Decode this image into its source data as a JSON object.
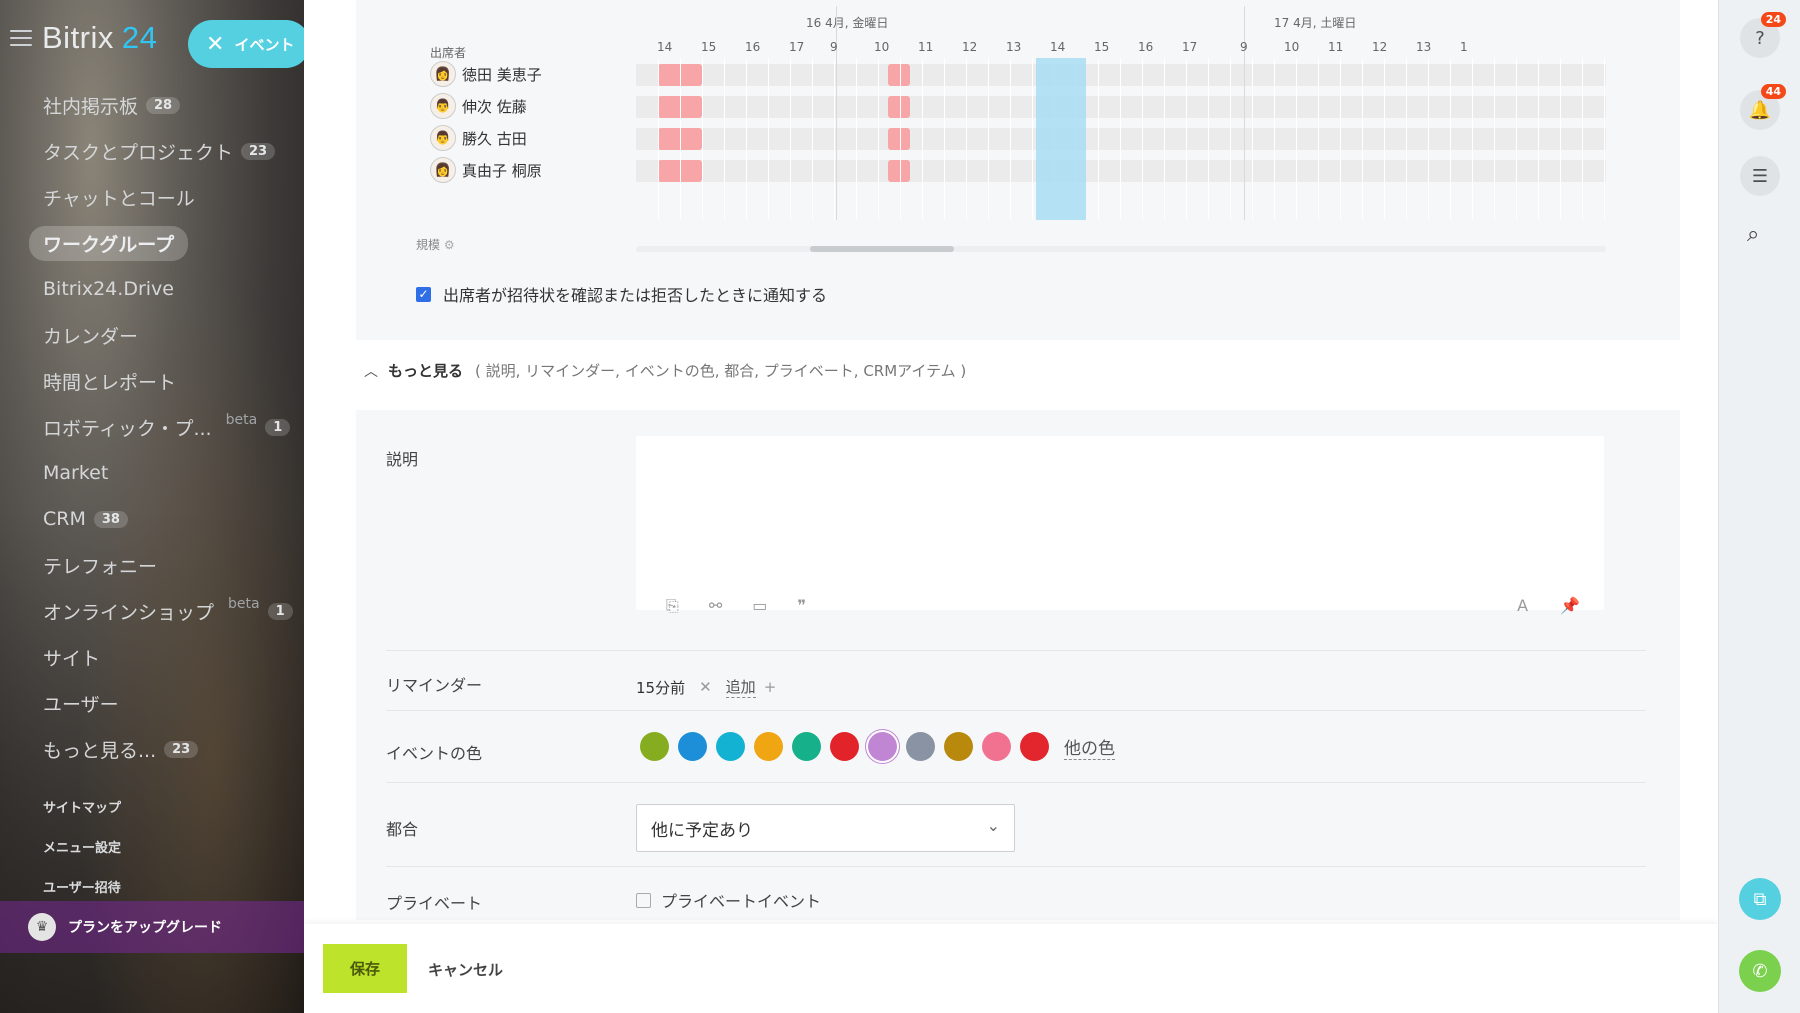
{
  "sidebar": {
    "logo_main": "Bitrix",
    "logo_num": "24",
    "event_pill": "イベント",
    "items": [
      {
        "label": "社内掲示板",
        "count": "28"
      },
      {
        "label": "タスクとプロジェクト",
        "count": "23"
      },
      {
        "label": "チャットとコール",
        "count": ""
      },
      {
        "label": "ワークグループ",
        "count": ""
      },
      {
        "label": "Bitrix24.Drive",
        "count": ""
      },
      {
        "label": "カレンダー",
        "count": ""
      },
      {
        "label": "時間とレポート",
        "count": ""
      },
      {
        "label": "ロボティック・プ...",
        "count": "1",
        "beta": "beta"
      },
      {
        "label": "Market",
        "count": ""
      },
      {
        "label": "CRM",
        "count": "38"
      },
      {
        "label": "テレフォニー",
        "count": ""
      },
      {
        "label": "オンラインショップ",
        "count": "1",
        "beta": "beta"
      },
      {
        "label": "サイト",
        "count": ""
      },
      {
        "label": "ユーザー",
        "count": ""
      },
      {
        "label": "もっと見る...",
        "count": "23"
      }
    ],
    "small_items": [
      "サイトマップ",
      "メニュー設定",
      "ユーザー招待"
    ],
    "upgrade": "プランをアップグレード"
  },
  "planner": {
    "attendees_label": "出席者",
    "day1": "16 4月, 金曜日",
    "day2": "17 4月, 土曜日",
    "hours_prev": [
      "14",
      "15",
      "16",
      "17"
    ],
    "hours_day1": [
      "9",
      "10",
      "11",
      "12",
      "13",
      "14",
      "15",
      "16",
      "17"
    ],
    "hours_day2": [
      "9",
      "10",
      "11",
      "12",
      "13",
      "1"
    ],
    "attendees": [
      "徳田 美恵子",
      "伸次 佐藤",
      "勝久 古田",
      "真由子 桐原"
    ],
    "scale_label": "規模"
  },
  "notify_label": "出席者が招待状を確認または拒否したときに通知する",
  "more": {
    "label": "もっと見る",
    "hint": "( 説明, リマインダー, イベントの色, 都合, プライベート, CRMアイテム )"
  },
  "form": {
    "description_label": "説明",
    "reminder_label": "リマインダー",
    "reminder_value": "15分前",
    "reminder_add": "追加",
    "color_label": "イベントの色",
    "colors": [
      "#86ad1f",
      "#1c8fd8",
      "#13b1d2",
      "#f0a512",
      "#16b18b",
      "#e3232a",
      "#c086d4",
      "#8a93a3",
      "#b8890c",
      "#f07290",
      "#e3262d"
    ],
    "selected_color": "#c086d4",
    "more_colors": "他の色",
    "availability_label": "都合",
    "availability_value": "他に予定あり",
    "private_label": "プライベート",
    "private_checkbox": "プライベートイベント"
  },
  "footer": {
    "save": "保存",
    "cancel": "キャンセル"
  },
  "rpanel": {
    "help_badge": "24",
    "notif_badge": "44"
  }
}
